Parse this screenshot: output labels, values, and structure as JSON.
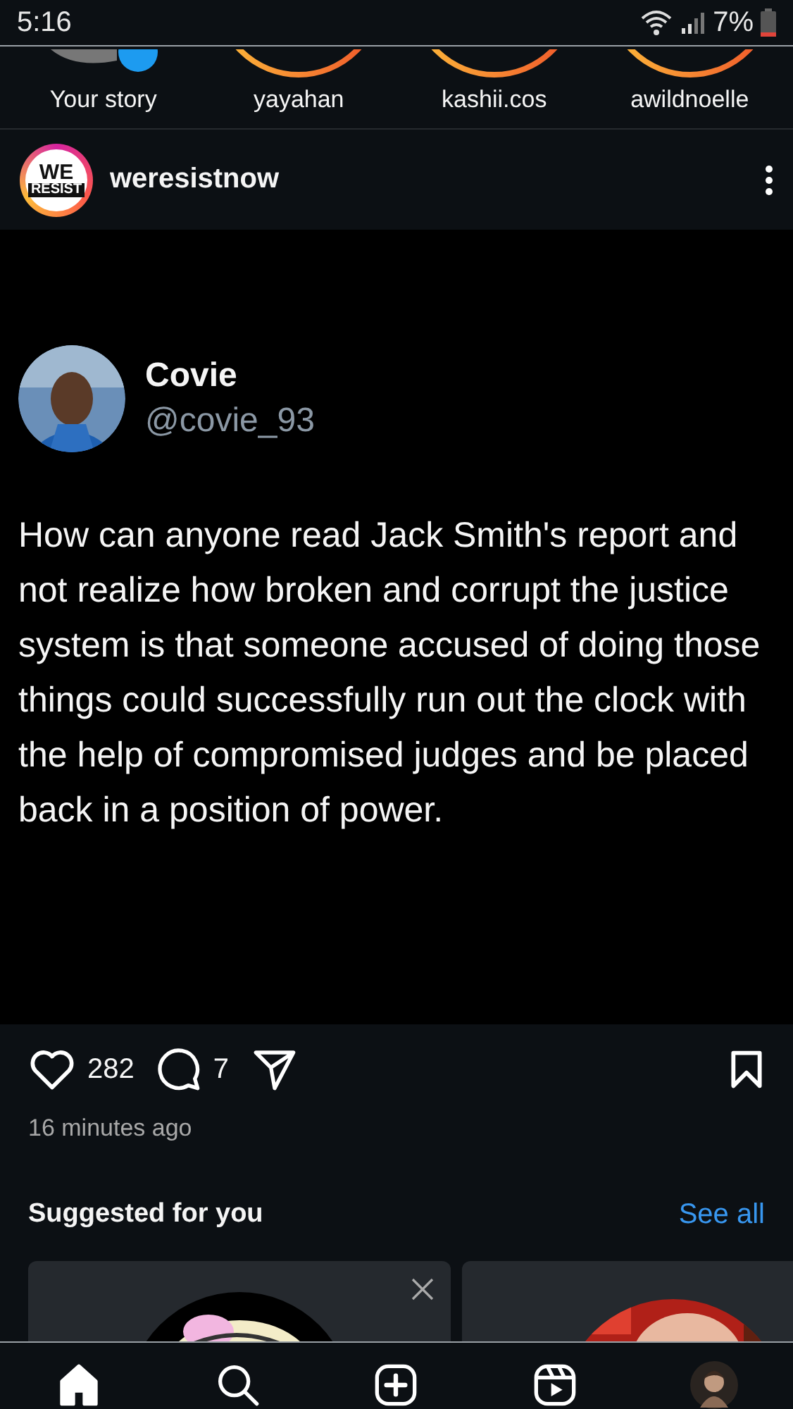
{
  "status_bar": {
    "time": "5:16",
    "battery": "7%"
  },
  "stories": [
    {
      "name": "Your story",
      "kind": "own"
    },
    {
      "name": "yayahan",
      "kind": "ring"
    },
    {
      "name": "kashii.cos",
      "kind": "ring"
    },
    {
      "name": "awildnoelle",
      "kind": "ring"
    }
  ],
  "post": {
    "account": "weresistnow",
    "logo_lines": [
      "WE",
      "RESIST"
    ],
    "tweet": {
      "name": "Covie",
      "handle": "@covie_93",
      "text": "How can anyone read Jack Smith's report and not realize how broken and corrupt the justice system is that someone accused of doing those things could successfully run out the clock with the help of compromised judges and be placed back in a position of power."
    },
    "likes": "282",
    "comments": "7",
    "liked": false,
    "saved": false,
    "time": "16 minutes ago"
  },
  "suggested": {
    "title": "Suggested for you",
    "link": "See all"
  },
  "nav": [
    {
      "kind": "home",
      "selected": true
    },
    {
      "kind": "search",
      "selected": false
    },
    {
      "kind": "create",
      "selected": false
    },
    {
      "kind": "reels",
      "selected": false
    },
    {
      "kind": "profile",
      "selected": false
    }
  ]
}
